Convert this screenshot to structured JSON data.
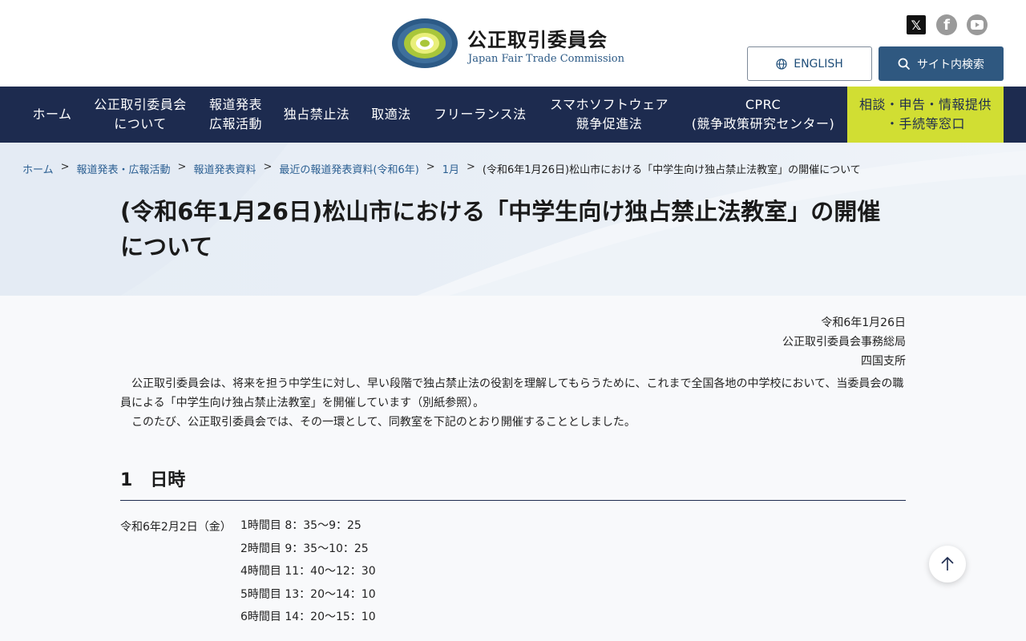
{
  "header": {
    "title_ja": "公正取引委員会",
    "title_en": "Japan Fair Trade Commission",
    "social": [
      "x-icon",
      "facebook-icon",
      "youtube-icon"
    ],
    "english_label": "ENGLISH",
    "search_label": "サイト内検索"
  },
  "nav": {
    "items": [
      {
        "label": "ホーム"
      },
      {
        "label": "公正取引委員会\nについて"
      },
      {
        "label": "報道発表\n広報活動"
      },
      {
        "label": "独占禁止法"
      },
      {
        "label": "取適法"
      },
      {
        "label": "フリーランス法"
      },
      {
        "label": "スマホソフトウェア\n競争促進法"
      },
      {
        "label": "CPRC\n(競争政策研究センター)"
      }
    ],
    "consult": "相談・申告・情報提供\n・手続等窓口"
  },
  "breadcrumb": {
    "links": [
      "ホーム",
      "報道発表・広報活動",
      "報道発表資料",
      "最近の報道発表資料(令和6年)",
      "1月"
    ],
    "separator": ">",
    "current": "(令和6年1月26日)松山市における「中学生向け独占禁止法教室」の開催について"
  },
  "page": {
    "title_line1": "(令和6年1月26日)松山市における「中学生向け独占禁止法教室」の開催",
    "title_line2": "について",
    "date": "令和6年1月26日",
    "org": "公正取引委員会事務総局",
    "office": "四国支所",
    "para1": "公正取引委員会は、将来を担う中学生に対し、早い段階で独占禁止法の役割を理解してもらうために、これまで全国各地の中学校において、当委員会の職員による「中学生向け独占禁止法教室」を開催しています（別紙参照）。",
    "para2": "このたび、公正取引委員会では、その一環として、同教室を下記のとおり開催することとしました。",
    "section1": "1　日時",
    "schedule_date": "令和6年2月2日（金）",
    "schedule": [
      "1時間目 8：35〜9：25",
      "2時間目 9：35〜10：25",
      "4時間目 11：40〜12：30",
      "5時間目 13：20〜14：10",
      "6時間目 14：20〜15：10"
    ]
  },
  "colors": {
    "nav_bg": "#1d2b4f",
    "consult_bg": "#d1de33",
    "search_btn": "#2f5880",
    "link": "#2b5f92"
  }
}
